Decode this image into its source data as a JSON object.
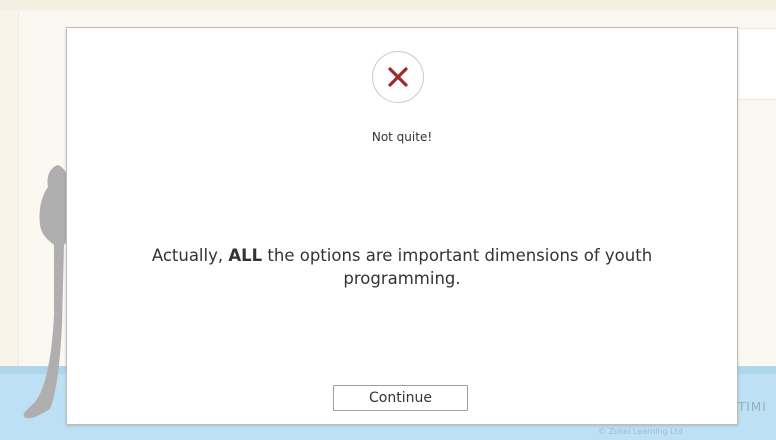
{
  "modal": {
    "status_icon": "x-mark-icon",
    "status_icon_color": "#a0282d",
    "heading": "Not quite!",
    "message_prefix": "Actually, ",
    "message_emphasis": "ALL",
    "message_suffix": " the options are important dimensions of youth programming.",
    "continue_label": "Continue"
  },
  "background": {
    "partial_text_right": "TIMI",
    "partial_text_bottom": "© Zokei Learning Ltd"
  }
}
